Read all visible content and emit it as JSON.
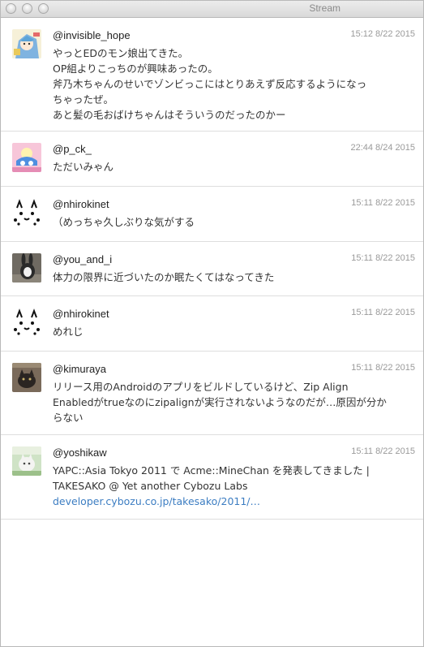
{
  "window": {
    "title": "Stream"
  },
  "tweets": [
    {
      "user": "@invisible_hope",
      "time": "15:12 8/22 2015",
      "lines": [
        "やっとEDのモン娘出てきた。",
        "OP組よりこっちのが興味あったの。",
        "斧乃木ちゃんのせいでゾンビっこにはとりあえず反応するようになっ",
        "ちゃったぜ。",
        "あと髪の毛おばけちゃんはそういうのだったのかー"
      ]
    },
    {
      "user": "@p_ck_",
      "time": "22:44 8/24 2015",
      "lines": [
        "ただいみゃん"
      ]
    },
    {
      "user": "@nhirokinet",
      "time": "15:11 8/22 2015",
      "lines": [
        "（めっちゃ久しぶりな気がする"
      ]
    },
    {
      "user": "@you_and_i",
      "time": "15:11 8/22 2015",
      "lines": [
        "体力の限界に近づいたのか眠たくてはなってきた"
      ]
    },
    {
      "user": "@nhirokinet",
      "time": "15:11 8/22 2015",
      "lines": [
        "めれじ"
      ]
    },
    {
      "user": "@kimuraya",
      "time": "15:11 8/22 2015",
      "lines": [
        "リリース用のAndroidのアプリをビルドしているけど、Zip Align",
        "Enabledがtrueなのにzipalignが実行されないようなのだが…原因が分か",
        "らない"
      ]
    },
    {
      "user": "@yoshikaw",
      "time": "15:11 8/22 2015",
      "lines": [
        "YAPC::Asia Tokyo 2011 で Acme::MineChan を発表してきました |",
        "TAKESAKO @ Yet another Cybozu Labs"
      ],
      "link": "developer.cybozu.co.jp/takesako/2011/…"
    }
  ]
}
